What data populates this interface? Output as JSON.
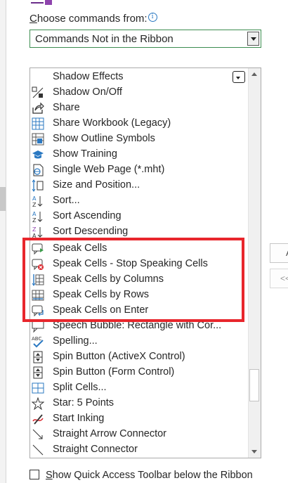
{
  "choose_commands": {
    "label_prefix": "C",
    "label_rest": "hoose commands from:",
    "info_glyph": "i",
    "selected_value": "Commands Not in the Ribbon"
  },
  "commands": [
    {
      "label": "Shadow Effects",
      "icon": "shadow-effects-icon"
    },
    {
      "label": "Shadow On/Off",
      "icon": "shadow-toggle-icon"
    },
    {
      "label": "Share",
      "icon": "share-icon"
    },
    {
      "label": "Share Workbook (Legacy)",
      "icon": "share-workbook-icon"
    },
    {
      "label": "Show Outline Symbols",
      "icon": "outline-symbols-icon"
    },
    {
      "label": "Show Training",
      "icon": "graduation-cap-icon"
    },
    {
      "label": "Single Web Page (*.mht)",
      "icon": "web-page-icon"
    },
    {
      "label": "Size and Position...",
      "icon": "size-position-icon"
    },
    {
      "label": "Sort...",
      "icon": "sort-dialog-icon"
    },
    {
      "label": "Sort Ascending",
      "icon": "sort-ascending-icon"
    },
    {
      "label": "Sort Descending",
      "icon": "sort-descending-icon"
    },
    {
      "label": "Speak Cells",
      "icon": "speak-cells-icon"
    },
    {
      "label": "Speak Cells - Stop Speaking Cells",
      "icon": "stop-speaking-icon"
    },
    {
      "label": "Speak Cells by Columns",
      "icon": "speak-columns-icon"
    },
    {
      "label": "Speak Cells by Rows",
      "icon": "speak-rows-icon"
    },
    {
      "label": "Speak Cells on Enter",
      "icon": "speak-on-enter-icon"
    },
    {
      "label": "Speech Bubble: Rectangle with Cor...",
      "icon": "speech-bubble-icon"
    },
    {
      "label": "Spelling...",
      "icon": "spelling-icon"
    },
    {
      "label": "Spin Button (ActiveX Control)",
      "icon": "spin-button-activex-icon"
    },
    {
      "label": "Spin Button (Form Control)",
      "icon": "spin-button-form-icon"
    },
    {
      "label": "Split Cells...",
      "icon": "split-cells-icon"
    },
    {
      "label": "Star: 5 Points",
      "icon": "star-icon"
    },
    {
      "label": "Start Inking",
      "icon": "inking-icon"
    },
    {
      "label": "Straight Arrow Connector",
      "icon": "arrow-connector-icon"
    },
    {
      "label": "Straight Connector",
      "icon": "straight-connector-icon"
    }
  ],
  "side_buttons": {
    "add_glyph": "A",
    "remove_glyph": "<<"
  },
  "qat_option": {
    "label_prefix": "S",
    "label_rest": "how Quick Access Toolbar below the Ribbon",
    "checked": false
  },
  "colors": {
    "highlight": "#e8262c",
    "accent_blue": "#2b79c2",
    "combo_border": "#3c8d50"
  }
}
